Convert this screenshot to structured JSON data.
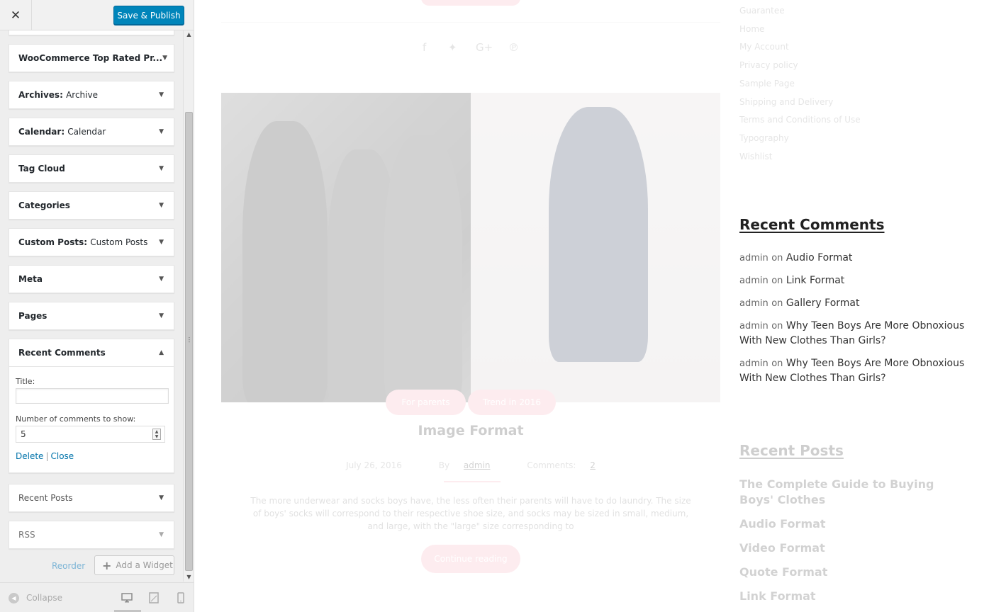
{
  "topbar": {
    "close_label": "✕",
    "publish_label": "Save & Publish"
  },
  "widgets": [
    {
      "name": "WooCommerce Top Rated Pr...",
      "sub": ""
    },
    {
      "name": "Archives",
      "sub": "Archive"
    },
    {
      "name": "Calendar",
      "sub": "Calendar"
    },
    {
      "name": "Tag Cloud",
      "sub": ""
    },
    {
      "name": "Categories",
      "sub": ""
    },
    {
      "name": "Custom Posts",
      "sub": "Custom Posts"
    },
    {
      "name": "Meta",
      "sub": ""
    },
    {
      "name": "Pages",
      "sub": ""
    }
  ],
  "open_widget": {
    "name": "Recent Comments",
    "title_label": "Title:",
    "title_value": "",
    "number_label": "Number of comments to show:",
    "number_value": "5",
    "delete_label": "Delete",
    "separator": "|",
    "close_label": "Close"
  },
  "after_widgets": [
    {
      "name": "Recent Posts"
    },
    {
      "name": "RSS"
    }
  ],
  "actions": {
    "reorder_label": "Reorder",
    "add_widget_label": "Add a Widget"
  },
  "footer": {
    "collapse_label": "Collapse"
  },
  "icons": {
    "arrow_down": "▼",
    "arrow_up": "▲",
    "plus": "+",
    "scroll_up": "▲",
    "scroll_down": "▼"
  },
  "preview": {
    "post_tags": [
      "For parents",
      "Trend in 2016"
    ],
    "post_title": "Image Format",
    "post_date": "July 26, 2016",
    "post_by": "By",
    "post_author": "admin",
    "post_comments_label": "Comments:",
    "post_comments_count": "2",
    "post_excerpt": "The more underwear and socks boys have, the less often their parents will have to do laundry. The size of boys' socks will correspond to their respective shoe size, and socks may be sized in small, medium, and large, with the \"large\" size corresponding to",
    "continue_label": "Continue reading",
    "pages": [
      "Guarantee",
      "Home",
      "My Account",
      "Privacy policy",
      "Sample Page",
      "Shipping and Delivery",
      "Terms and Conditions of Use",
      "Typography",
      "Wishlist"
    ],
    "recent_comments_title": "Recent Comments",
    "recent_comments": [
      {
        "author": "admin",
        "on": "on",
        "post": "Audio Format"
      },
      {
        "author": "admin",
        "on": "on",
        "post": "Link Format"
      },
      {
        "author": "admin",
        "on": "on",
        "post": "Gallery Format"
      },
      {
        "author": "admin",
        "on": "on",
        "post": "Why Teen Boys Are More Obnoxious With New Clothes Than Girls?"
      },
      {
        "author": "admin",
        "on": "on",
        "post": "Why Teen Boys Are More Obnoxious With New Clothes Than Girls?"
      }
    ],
    "recent_posts_title": "Recent Posts",
    "recent_posts": [
      "The Complete Guide to Buying Boys' Clothes",
      "Audio Format",
      "Video Format",
      "Quote Format",
      "Link Format"
    ]
  }
}
